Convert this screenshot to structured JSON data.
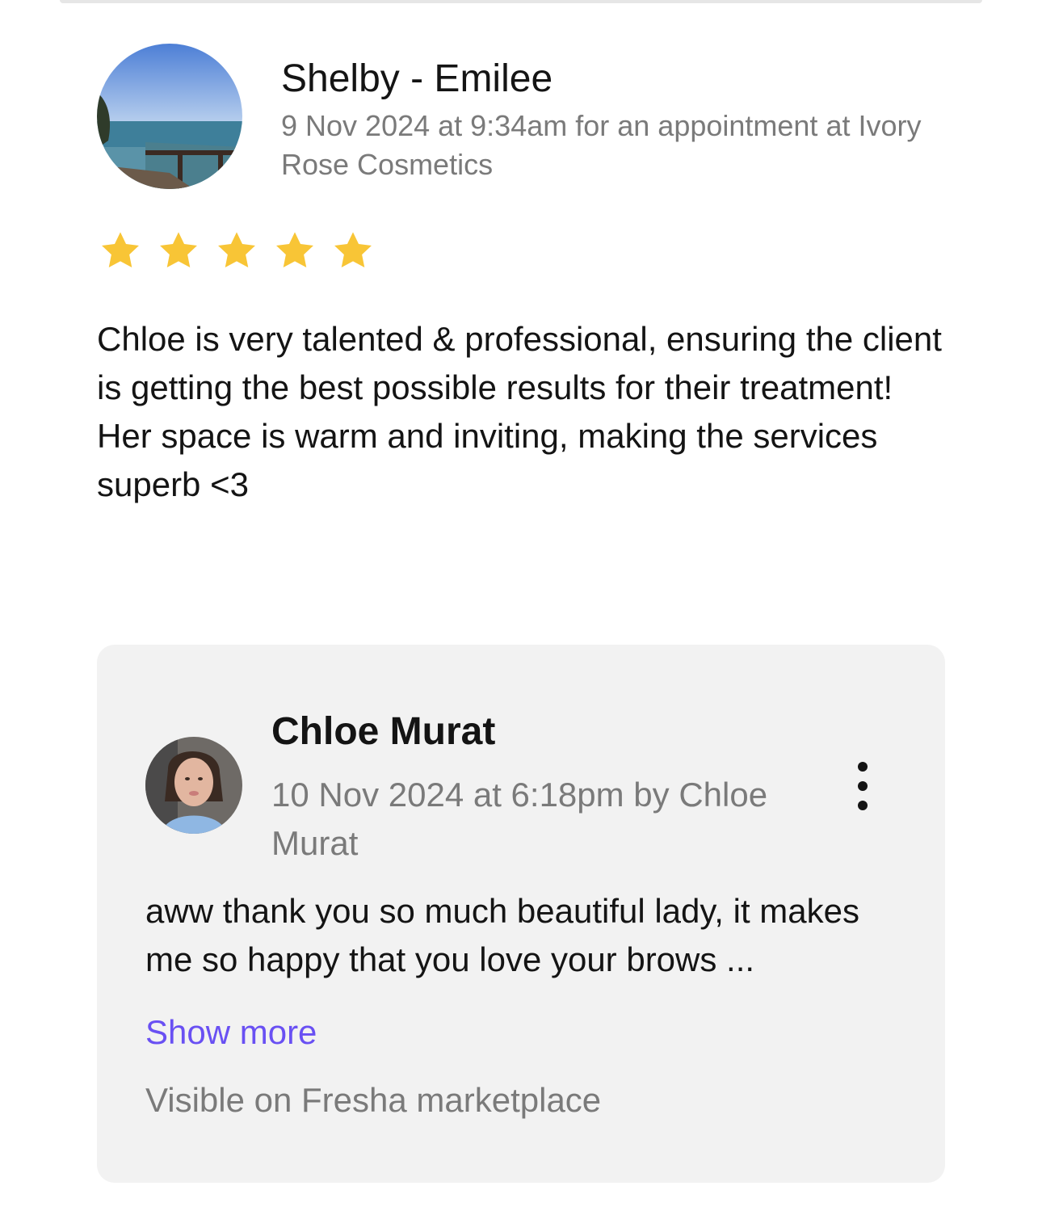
{
  "review": {
    "reviewer_name": "Shelby - Emilee",
    "meta": "9 Nov 2024 at 9:34am for an appointment at Ivory Rose Cosmetics",
    "rating": 5,
    "rating_max": 5,
    "star_color": "#f8c536",
    "text_line1": "Chloe is very talented & professional, ensuring the client is getting the best possible results for their treatment!",
    "text_line2": "Her space is warm and inviting, making the services superb <3"
  },
  "reply": {
    "author_name": "Chloe Murat",
    "meta": "10 Nov 2024 at 6:18pm by Chloe Murat",
    "text": "aww thank you so much beautiful lady, it makes me so happy that you love your brows ...",
    "show_more_label": "Show more",
    "visibility_label": "Visible on Fresha marketplace",
    "more_icon": "more-vertical-icon",
    "link_color": "#6950f3",
    "card_background": "#f2f2f2"
  }
}
